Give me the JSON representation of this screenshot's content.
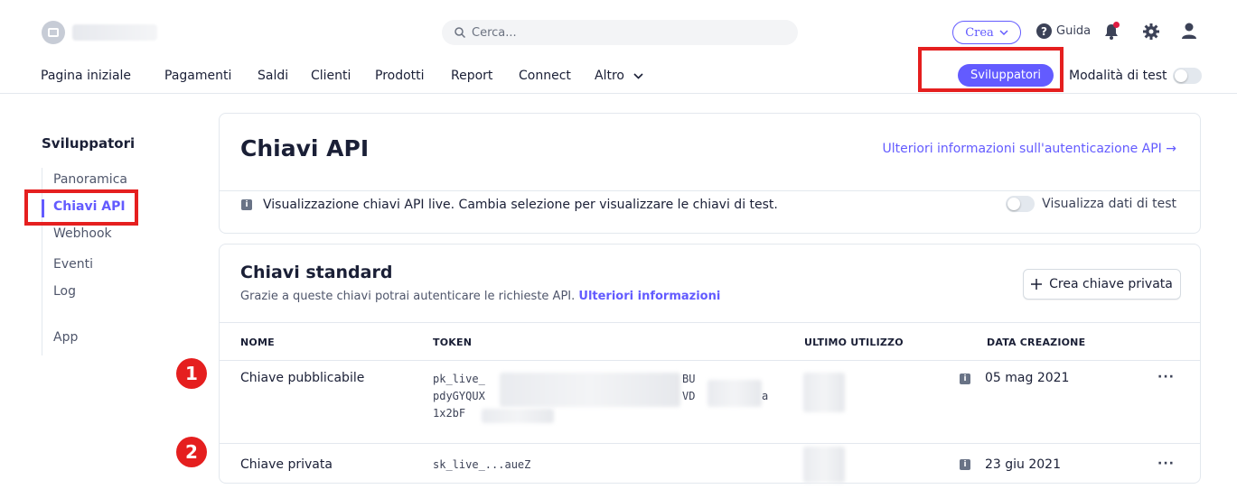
{
  "topbar": {
    "search_placeholder": "Cerca...",
    "create_label": "Crea",
    "help_label": "Guida"
  },
  "nav": {
    "items": [
      "Pagina iniziale",
      "Pagamenti",
      "Saldi",
      "Clienti",
      "Prodotti",
      "Report",
      "Connect",
      "Altro"
    ],
    "developers": "Sviluppatori",
    "test_mode": "Modalità di test"
  },
  "sidebar": {
    "title": "Sviluppatori",
    "items": [
      "Panoramica",
      "Chiavi API",
      "Webhook",
      "Eventi",
      "Log",
      "App"
    ]
  },
  "api_keys": {
    "title": "Chiavi API",
    "auth_link": "Ulteriori informazioni sull'autenticazione API →",
    "info_text": "Visualizzazione chiavi API live. Cambia selezione per visualizzare le chiavi di test.",
    "view_test": "Visualizza dati di test"
  },
  "standard": {
    "title": "Chiavi standard",
    "subtitle": "Grazie a queste chiavi potrai autenticare le richieste API.",
    "subtitle_link": "Ulteriori informazioni",
    "create_button": "Crea chiave privata",
    "columns": [
      "NOME",
      "TOKEN",
      "ULTIMO UTILIZZO",
      "DATA CREAZIONE"
    ],
    "rows": [
      {
        "badge": "1",
        "name": "Chiave pubblicabile",
        "token_lines": [
          "pk_live_",
          "pdyGYQUX",
          "1x2bF"
        ],
        "token_tail": [
          "BU",
          "VD",
          "a"
        ],
        "date": "05 mag 2021",
        "menu": "···"
      },
      {
        "badge": "2",
        "name": "Chiave privata",
        "token_lines": [
          "sk_live_...aueZ"
        ],
        "date": "23 giu 2021",
        "menu": "···"
      }
    ]
  }
}
